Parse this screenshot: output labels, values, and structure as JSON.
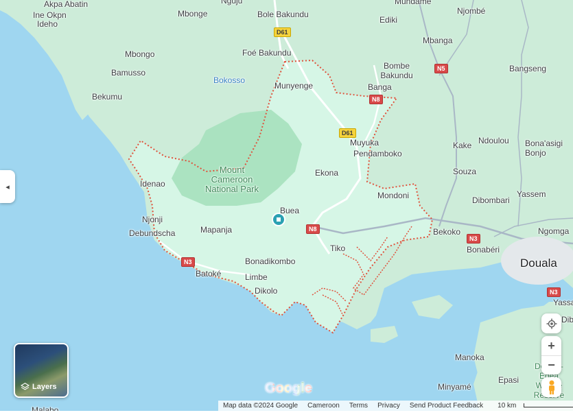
{
  "map": {
    "colors": {
      "water": "#9fd6f0",
      "land": "#cdecd9",
      "park": "#9edbb6",
      "highlight": "#d6f6e6",
      "boundary": "#e0513b",
      "road": "#ffffff",
      "major_road": "#a9b7c6"
    }
  },
  "labels": {
    "akpa_abatin": "Akpa Abatin",
    "ine_okpn": "Ine Okpn",
    "ideho": "Ideho",
    "mbonge": "Mbonge",
    "bole_bakundu": "Bole Bakundu",
    "ediki": "Ediki",
    "njombe": "Njombé",
    "mbongo": "Mbongo",
    "foe_bakundu": "Foé Bakundu",
    "mbanga": "Mbanga",
    "bamusso": "Bamusso",
    "bokosso": "Bokosso",
    "bombe_bakundu": "Bombe Bakundu",
    "bangseng": "Bangseng",
    "bekumu": "Bekumu",
    "munyenge": "Munyenge",
    "banga": "Banga",
    "muyuka": "Muyuka",
    "kake": "Kake",
    "ndoulou": "Ndoulou",
    "bona_asigi_bonjo": "Bona'asigi Bonjo",
    "pendamboko": "Pendamboko",
    "mount_cameroon": "Mount Cameroon National Park",
    "ekona": "Ekona",
    "souza": "Souza",
    "idenao": "Idenao",
    "mondoni": "Mondoni",
    "yassem": "Yassem",
    "dibombari": "Dibombari",
    "buea": "Buea",
    "njonji": "Njonji",
    "debundscha": "Debundscha",
    "mapanja": "Mapanja",
    "bekoko": "Bekoko",
    "ngomga": "Ngomga",
    "bonaberi": "Bonabéri",
    "tiko": "Tiko",
    "douala": "Douala",
    "bonadikombo": "Bonadikombo",
    "batoke": "Batoké",
    "limbe": "Limbe",
    "dikolo": "Dikolo",
    "yassa": "Yassa",
    "dib": "Dib",
    "manoka": "Manoka",
    "epasi": "Epasi",
    "minyame": "Minyamé",
    "douala_edea_reserve": "Douala-Edea Wildlife Reserve",
    "malabo": "Malabo",
    "mundame": "Mundame",
    "nguju": "Nguju"
  },
  "roads": {
    "d61_a": "D61",
    "d61_b": "D61",
    "n5": "N5",
    "n8_a": "N8",
    "n8_b": "N8",
    "n3_a": "N3",
    "n3_b": "N3",
    "n3_c": "N3"
  },
  "controls": {
    "layers_label": "Layers",
    "zoom_in": "+",
    "zoom_out": "−",
    "collapse": "◂"
  },
  "footer": {
    "map_data": "Map data ©2024 Google",
    "region": "Cameroon",
    "terms": "Terms",
    "privacy": "Privacy",
    "feedback": "Send Product Feedback",
    "scale": "10 km"
  },
  "logo": {
    "text": "Google"
  }
}
